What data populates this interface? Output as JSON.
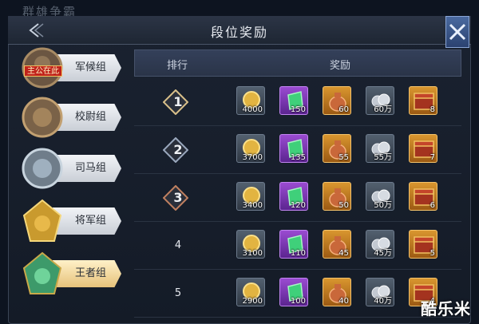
{
  "background_title": "群雄争霸",
  "header": {
    "title": "段位奖励"
  },
  "sidebar": {
    "items": [
      {
        "label": "军候组",
        "badge": "主公在此"
      },
      {
        "label": "校尉组"
      },
      {
        "label": "司马组"
      },
      {
        "label": "将军组"
      },
      {
        "label": "王者组"
      }
    ]
  },
  "table": {
    "headers": {
      "rank": "排行",
      "reward": "奖励"
    },
    "rows": [
      {
        "rank": "1",
        "rewards": [
          "4000",
          "150",
          "60",
          "60万",
          "8"
        ]
      },
      {
        "rank": "2",
        "rewards": [
          "3700",
          "135",
          "55",
          "55万",
          "7"
        ]
      },
      {
        "rank": "3",
        "rewards": [
          "3400",
          "120",
          "50",
          "50万",
          "6"
        ]
      },
      {
        "rank": "4",
        "rewards": [
          "3100",
          "110",
          "45",
          "45万",
          "5"
        ]
      },
      {
        "rank": "5",
        "rewards": [
          "2900",
          "100",
          "40",
          "40万",
          "4"
        ]
      }
    ]
  },
  "reward_icons": [
    "gold-coin-icon",
    "green-jade-icon",
    "money-bag-icon",
    "silver-coins-icon",
    "treasure-chest-icon"
  ],
  "colors": {
    "accent_gold": "#e6c27a",
    "rank1": "#d9c08a",
    "rank2": "#9aa8bd",
    "rank3": "#c08060"
  },
  "watermark": "酷乐米"
}
